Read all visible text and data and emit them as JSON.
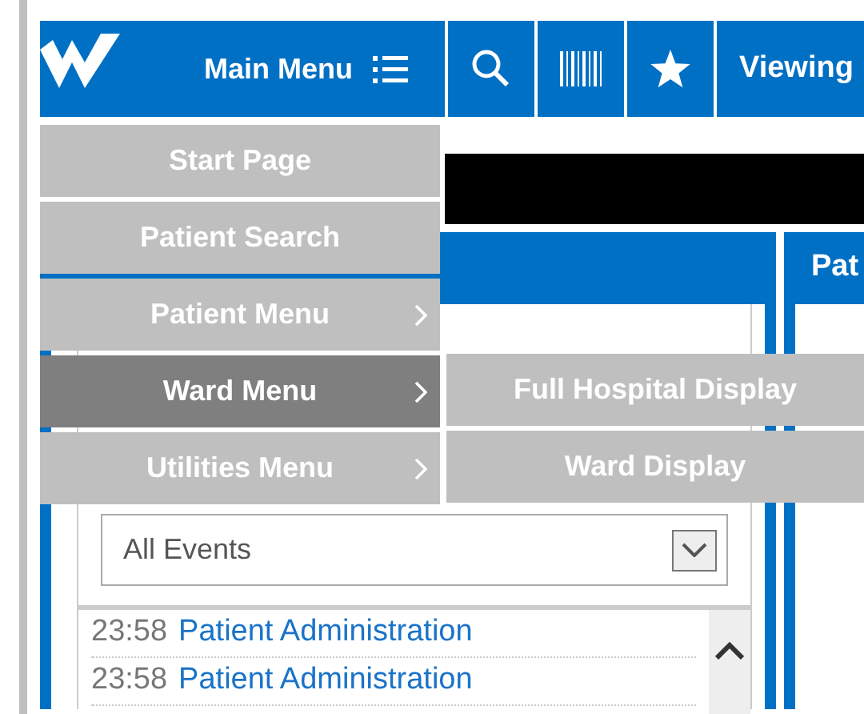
{
  "header": {
    "menu_button": "Main Menu",
    "viewing": "Viewing"
  },
  "menu": [
    {
      "label": "Start Page",
      "has_submenu": false,
      "selected": false
    },
    {
      "label": "Patient Search",
      "has_submenu": false,
      "selected": false
    },
    {
      "label": "Patient Menu",
      "has_submenu": true,
      "selected": false
    },
    {
      "label": "Ward Menu",
      "has_submenu": true,
      "selected": true
    },
    {
      "label": "Utilities Menu",
      "has_submenu": true,
      "selected": false
    }
  ],
  "submenu": [
    {
      "label": "Full Hospital Display"
    },
    {
      "label": "Ward Display"
    }
  ],
  "timeline_panel": {
    "filter": "All Events",
    "events": [
      {
        "time": "23:58",
        "event": "Patient Administration"
      },
      {
        "time": "23:58",
        "event": "Patient Administration"
      }
    ]
  },
  "patient_panel": {
    "title": "Pat"
  }
}
